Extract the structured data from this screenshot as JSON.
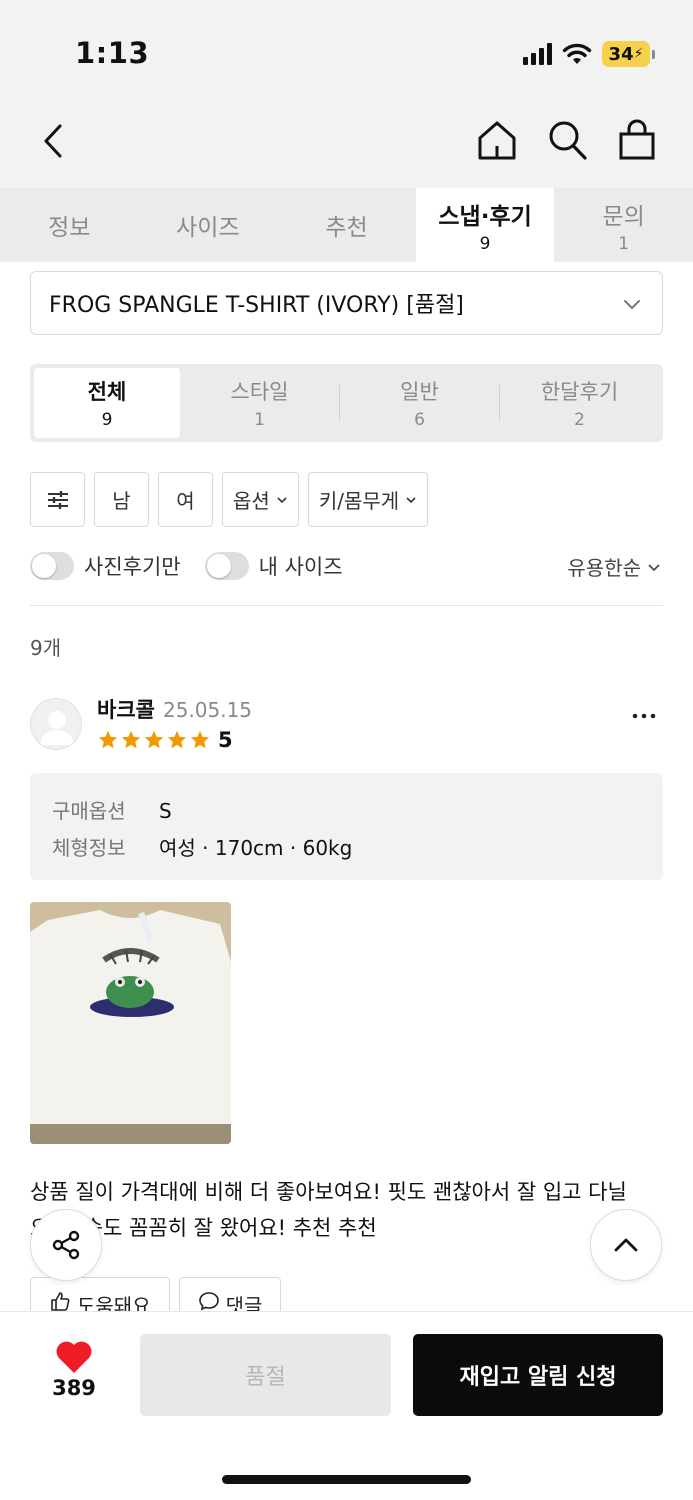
{
  "status_bar": {
    "time": "1:13",
    "battery": "34"
  },
  "tabs": [
    {
      "label": "정보",
      "count": ""
    },
    {
      "label": "사이즈",
      "count": ""
    },
    {
      "label": "추천",
      "count": ""
    },
    {
      "label": "스냅·후기",
      "count": "9"
    },
    {
      "label": "문의",
      "count": "1"
    }
  ],
  "product_select": {
    "value": "FROG SPANGLE T-SHIRT (IVORY) [품절]"
  },
  "review_types": [
    {
      "label": "전체",
      "count": "9"
    },
    {
      "label": "스타일",
      "count": "1"
    },
    {
      "label": "일반",
      "count": "6"
    },
    {
      "label": "한달후기",
      "count": "2"
    }
  ],
  "filters": {
    "male": "남",
    "female": "여",
    "option": "옵션",
    "height_weight": "키/몸무게"
  },
  "toggles": {
    "photo_only": "사진후기만",
    "my_size": "내 사이즈"
  },
  "sort": {
    "label": "유용한순"
  },
  "result_count": "9개",
  "review": {
    "reviewer": "바크콜",
    "date": "25.05.15",
    "rating": "5",
    "option_label": "구매옵션",
    "option_value": "S",
    "body_label": "체형정보",
    "body_value": "여성 · 170cm · 60kg",
    "text": "상품 질이 가격대에 비해 더 좋아보여요! 핏도 괜찮아서 잘 입고 다닐\n          요! 배송도 꼼꼼히 잘 왔어요! 추천 추천",
    "helpful_label": "도움돼요",
    "comment_label": "댓글"
  },
  "bottom_bar": {
    "like_count": "389",
    "soldout_label": "품절",
    "restock_label": "재입고 알림 신청"
  },
  "colors": {
    "accent_red": "#ee1c25",
    "star": "#f39800",
    "dark": "#0b0b0b"
  }
}
